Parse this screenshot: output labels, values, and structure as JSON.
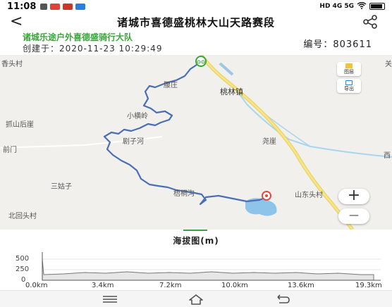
{
  "status": {
    "time": "11:08",
    "right_text": "HD 4G 5G",
    "battery": "43"
  },
  "header": {
    "back_label": "<",
    "title": "诸城市喜德盛桃林大山天路赛段"
  },
  "info": {
    "team": "诸城乐途户外喜德盛骑行大队",
    "created": "创建于：2020-11-23 10:29:49",
    "serial": "编号：803611"
  },
  "map": {
    "places": {
      "xiangtou": "香头村",
      "yaozhuang": "腰庄",
      "taolin": "桃林镇",
      "xiaohengling": "小横岭",
      "zhuashanhouya": "抓山后崖",
      "juzihe": "剧子河",
      "yaoya": "尧崖",
      "qianmen": "前门",
      "sanguzi": "三姑子",
      "zhuotonggou": "梧桐沟",
      "shandongtou": "山东头村",
      "beihuitou": "北回头村",
      "xi": "西",
      "guan": "关"
    },
    "layers_label": "图层",
    "export_label": "导出",
    "zoom_in": "+",
    "zoom_out": "—",
    "route_color": "#4a6fb5",
    "road_color": "#f0d458"
  },
  "elevation": {
    "tab_label": "海拔图(m)",
    "y_ticks": [
      "500",
      "250",
      "0"
    ],
    "x_ticks": [
      "0.0km",
      "3.4km",
      "7.2km",
      "10.0km",
      "13.6km",
      "19.3km"
    ]
  },
  "navbar": {
    "menu_icon": "menu-icon",
    "home_icon": "home-icon",
    "back_icon": "back-icon"
  }
}
